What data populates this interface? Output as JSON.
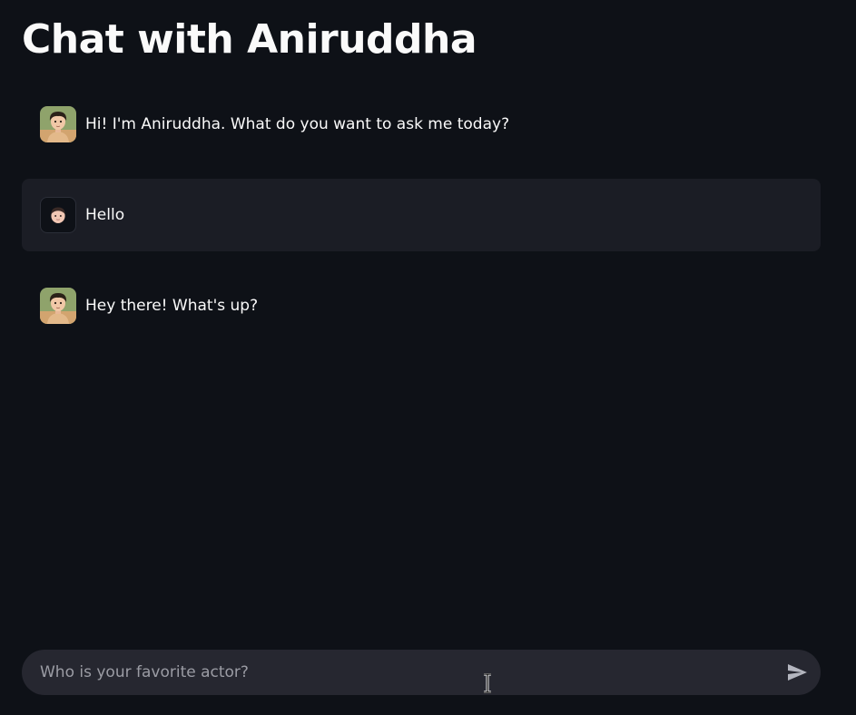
{
  "page": {
    "title": "Chat with Aniruddha"
  },
  "messages": [
    {
      "role": "assistant",
      "avatar": "assistant-avatar",
      "text": "Hi! I'm Aniruddha. What do you want to ask me today?"
    },
    {
      "role": "user",
      "avatar": "user-avatar",
      "text": "Hello"
    },
    {
      "role": "assistant",
      "avatar": "assistant-avatar",
      "text": "Hey there! What's up?"
    }
  ],
  "chat_input": {
    "placeholder": "Who is your favorite actor?",
    "value": "",
    "send_icon": "send-icon"
  },
  "colors": {
    "background": "#0e1117",
    "user_message_bg": "#1b1d25",
    "input_bg": "#262730",
    "text": "#fafafa",
    "placeholder": "#9b9ca4"
  }
}
